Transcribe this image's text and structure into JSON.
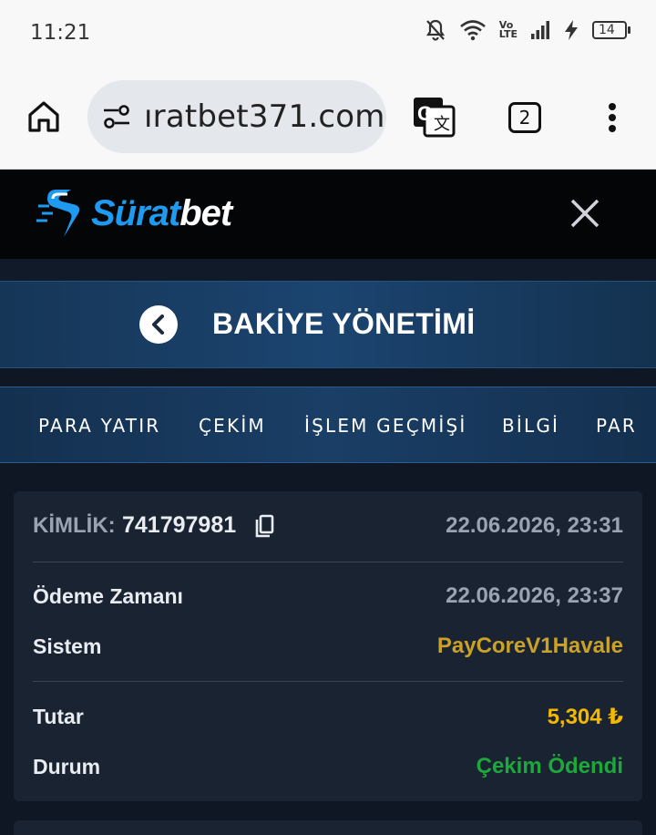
{
  "status_bar": {
    "time": "11:21",
    "network_label": "Vo\nLTE",
    "battery_level": "14"
  },
  "browser": {
    "url": "ıratbet371.com",
    "tab_count": "2"
  },
  "site": {
    "logo_part1": "Sürat",
    "logo_part2": "bet",
    "brand_blue": "#1e9bf0"
  },
  "page": {
    "title": "BAKİYE YÖNETİMİ"
  },
  "tabs": [
    {
      "label": "PARA YATIR"
    },
    {
      "label": "ÇEKİM"
    },
    {
      "label": "İŞLEM GEÇMİŞİ"
    },
    {
      "label": "BİLGİ"
    },
    {
      "label": "PAR"
    }
  ],
  "transaction": {
    "id_label": "KİMLİK:",
    "id_value": "741797981",
    "created_at": "22.06.2026, 23:31",
    "payment_time_label": "Ödeme Zamanı",
    "payment_time_value": "22.06.2026, 23:37",
    "system_label": "Sistem",
    "system_value": "PayCoreV1Havale",
    "amount_label": "Tutar",
    "amount_value": "5,304 ₺",
    "status_label": "Durum",
    "status_value": "Çekim Ödendi",
    "colors": {
      "system": "#c9a227",
      "amount": "#f5b800",
      "status": "#1ea83c"
    }
  }
}
